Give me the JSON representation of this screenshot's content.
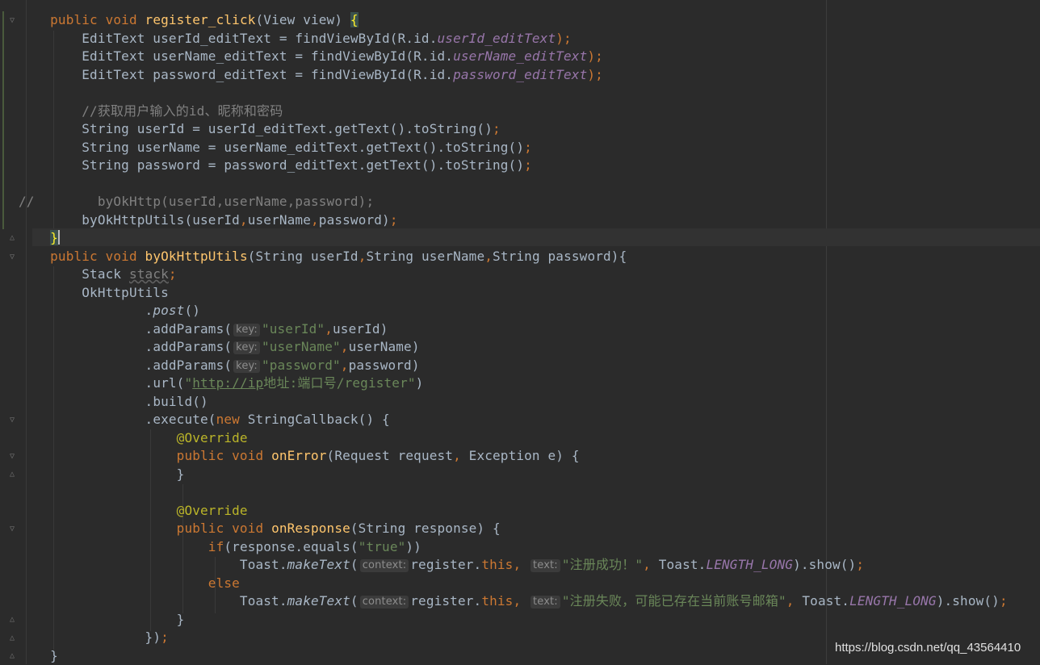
{
  "editor": {
    "line_comment_marker": "//",
    "watermark": "https://blog.csdn.net/qq_43564410"
  },
  "code": {
    "register_sig": {
      "mod": "public void ",
      "name": "register_click",
      "params": "(View view) ",
      "brace": "{"
    },
    "l2": {
      "a": "EditText userId_editText = findViewById(R.id.",
      "b": "userId_editText",
      "c": ");"
    },
    "l3": {
      "a": "EditText userName_editText = findViewById(R.id.",
      "b": "userName_editText",
      "c": ");"
    },
    "l4": {
      "a": "EditText password_editText = findViewById(R.id.",
      "b": "password_editText",
      "c": ");"
    },
    "comment_cn": "//获取用户输入的id、昵称和密码",
    "l7": {
      "a": "String userId = userId_editText.getText().toString()",
      "c": ";"
    },
    "l8": {
      "a": "String userName = userName_editText.getText().toString()",
      "c": ";"
    },
    "l9": {
      "a": "String password = password_editText.getText().toString()",
      "c": ";"
    },
    "commented_call": "        byOkHttp(userId,userName,password);",
    "l12": {
      "a": "byOkHttpUtils(userId",
      "s1": ",",
      "b": "userName",
      "s2": ",",
      "c": "password)",
      "d": ";"
    },
    "close_brace": "}",
    "utils_sig": {
      "mod": "public void ",
      "name": "byOkHttpUtils",
      "a": "(String userId",
      "s1": ",",
      "b": "String userName",
      "s2": ",",
      "c": "String password){"
    },
    "stack": {
      "a": "Stack ",
      "b": "stack",
      "c": ";"
    },
    "okhttp": "OkHttpUtils",
    "post": {
      "dot": ".",
      "name": "post",
      "paren": "()"
    },
    "hint_key": "key:",
    "p1": {
      "a": ".addParams(",
      "s": "\"userId\"",
      "sep": ",",
      "b": "userId)"
    },
    "p2": {
      "a": ".addParams(",
      "s": "\"userName\"",
      "sep": ",",
      "b": "userName)"
    },
    "p3": {
      "a": ".addParams(",
      "s": "\"password\"",
      "sep": ",",
      "b": "password)"
    },
    "url": {
      "a": ".url(",
      "q1": "\"",
      "link": "http://ip",
      "rest": "地址:端口号/register\"",
      "b": ")"
    },
    "build": ".build()",
    "execute": {
      "a": ".execute(",
      "kw": "new",
      "b": " StringCallback() {"
    },
    "override": "@Override",
    "onerror": {
      "mod": "public void ",
      "name": "onError",
      "a": "(Request request",
      "s": ",",
      "b": " Exception e) {"
    },
    "close1": "}",
    "onresponse": {
      "mod": "public void ",
      "name": "onResponse",
      "a": "(String response) {"
    },
    "iff": {
      "kw": "if",
      "a": "(response.equals(",
      "s": "\"true\"",
      "b": "))"
    },
    "hint_context": "context:",
    "hint_text": "text:",
    "toast1": {
      "a": "Toast.",
      "m": "makeText",
      "p": "(",
      "b": "register.",
      "th": "this",
      "s1": ", ",
      "str": "\"注册成功！\"",
      "s2": ", ",
      "c": "Toast.",
      "f": "LENGTH_LONG",
      "d": ").show()",
      "e": ";"
    },
    "else": "else",
    "toast2": {
      "a": "Toast.",
      "m": "makeText",
      "p": "(",
      "b": "register.",
      "th": "this",
      "s1": ", ",
      "str": "\"注册失败，可能已存在当前账号邮箱\"",
      "s2": ", ",
      "c": "Toast.",
      "f": "LENGTH_LONG",
      "d": ").show()",
      "e": ";"
    },
    "close2": "}",
    "close3": {
      "a": "})",
      "b": ";"
    },
    "close4": "}"
  }
}
